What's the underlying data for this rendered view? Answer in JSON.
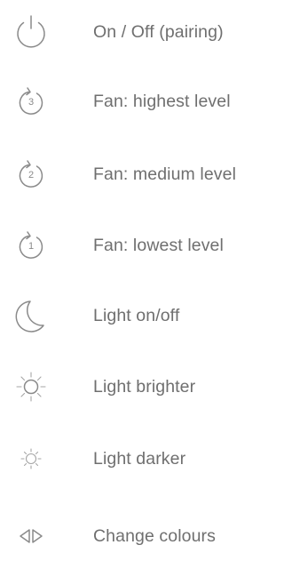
{
  "legend": {
    "items": [
      {
        "icon": "power-icon",
        "label": "On / Off (pairing)"
      },
      {
        "icon": "fan-level-3-icon",
        "level_number": "3",
        "label": "Fan: highest level"
      },
      {
        "icon": "fan-level-2-icon",
        "level_number": "2",
        "label": "Fan: medium level"
      },
      {
        "icon": "fan-level-1-icon",
        "level_number": "1",
        "label": "Fan: lowest level"
      },
      {
        "icon": "moon-icon",
        "label": "Light on/off"
      },
      {
        "icon": "sun-large-icon",
        "label": "Light brighter"
      },
      {
        "icon": "sun-small-icon",
        "label": "Light darker"
      },
      {
        "icon": "left-right-arrows-icon",
        "label": "Change colours"
      }
    ]
  },
  "colors": {
    "icon_stroke": "#8a8a8a",
    "label_text": "#6f6f6f",
    "background": "#ffffff"
  }
}
